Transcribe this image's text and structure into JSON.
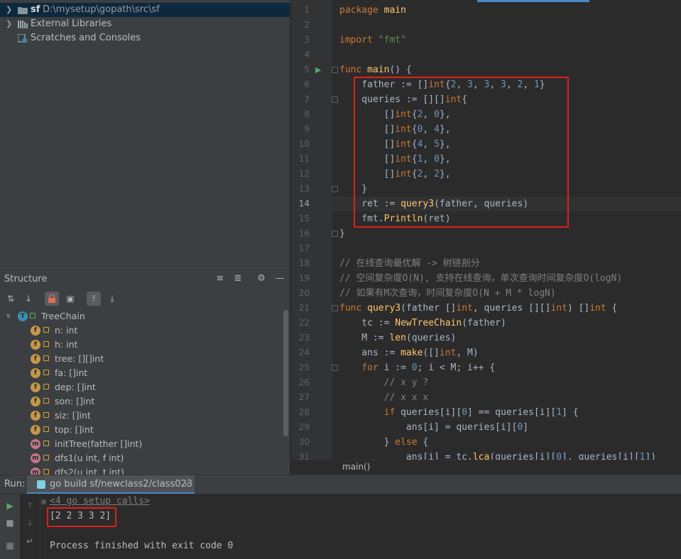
{
  "project_tree": {
    "root": {
      "name": "sf",
      "path": "D:\\mysetup\\gopath\\src\\sf"
    },
    "external_libraries": "External Libraries",
    "scratches": "Scratches and Consoles"
  },
  "structure": {
    "title": "Structure",
    "class_name": "TreeChain",
    "members": [
      {
        "kind": "f",
        "label": "n: int"
      },
      {
        "kind": "f",
        "label": "h: int"
      },
      {
        "kind": "f",
        "label": "tree: [][]int"
      },
      {
        "kind": "f",
        "label": "fa: []int"
      },
      {
        "kind": "f",
        "label": "dep: []int"
      },
      {
        "kind": "f",
        "label": "son: []int"
      },
      {
        "kind": "f",
        "label": "siz: []int"
      },
      {
        "kind": "f",
        "label": "top: []int"
      },
      {
        "kind": "m",
        "label": "initTree(father []int)"
      },
      {
        "kind": "m",
        "label": "dfs1(u int, f int)"
      },
      {
        "kind": "m",
        "label": "dfs2(u int, t int)"
      }
    ]
  },
  "editor": {
    "current_line": 14,
    "breadcrumb": "main()",
    "line_numbers": [
      "1",
      "2",
      "3",
      "4",
      "5",
      "6",
      "7",
      "8",
      "9",
      "10",
      "11",
      "12",
      "13",
      "14",
      "15",
      "16",
      "17",
      "18",
      "19",
      "20",
      "21",
      "22",
      "23",
      "24",
      "25",
      "26",
      "27",
      "28",
      "29",
      "30",
      "31"
    ],
    "lines": [
      "package main",
      "",
      "import \"fmt\"",
      "",
      "func main() {",
      "    father := []int{2, 3, 3, 3, 2, 1}",
      "    queries := [][]int{",
      "        []int{2, 0},",
      "        []int{0, 4},",
      "        []int{4, 5},",
      "        []int{1, 0},",
      "        []int{2, 2},",
      "    }",
      "    ret := query3(father, queries)",
      "    fmt.Println(ret)",
      "}",
      "",
      "// 在线查询最优解 -> 树链剖分",
      "// 空间复杂度O(N), 支持在线查询，单次查询时间复杂度O(logN)",
      "// 如果有M次查询，时间复杂度O(N + M * logN)",
      "func query3(father []int, queries [][]int) []int {",
      "    tc := NewTreeChain(father)",
      "    M := len(queries)",
      "    ans := make([]int, M)",
      "    for i := 0; i < M; i++ {",
      "        // x y ?",
      "        // x x x",
      "        if queries[i][0] == queries[i][1] {",
      "            ans[i] = queries[i][0]",
      "        } else {",
      "            ans[i] = tc.lca(queries[i][0], queries[i][1])"
    ]
  },
  "run": {
    "label": "Run:",
    "tab_title": "go build sf/newclass2/class023",
    "output": {
      "setup": "<4 go setup calls>",
      "result": "[2 2 3 3 2]",
      "blank": "",
      "finished": "Process finished with exit code 0"
    }
  },
  "colors": {
    "annotation_red": "#e0201b",
    "accent_blue": "#4a88c7"
  }
}
